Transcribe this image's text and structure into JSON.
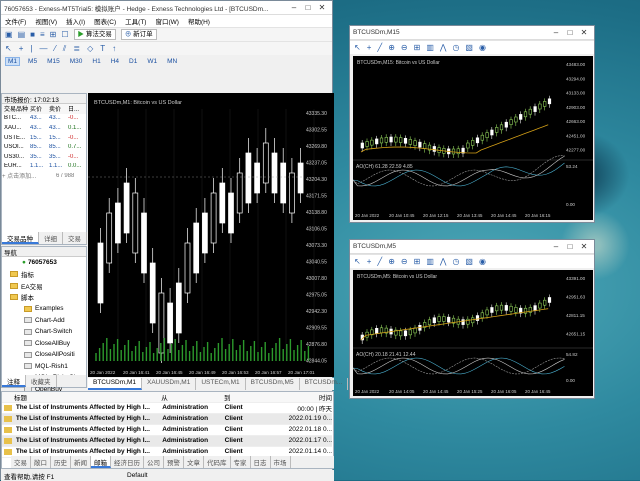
{
  "main": {
    "title": "76057653 - Exness-MT5Trial5: 模拟账户 - Hedge - Exness Technologies Ltd - [BTCUSDm...",
    "menu": [
      "文件(F)",
      "视图(V)",
      "插入(I)",
      "图表(C)",
      "工具(T)",
      "窗口(W)",
      "帮助(H)"
    ],
    "algo_label": "算法交易",
    "new_order_label": "新订单",
    "timeframes": [
      "M1",
      "M5",
      "M15",
      "M30",
      "H1",
      "H4",
      "D1",
      "W1",
      "MN"
    ],
    "mw_header": "市场报价: 17:02:13",
    "mw_cols": [
      "交易品种",
      "买价",
      "卖价",
      "日..."
    ],
    "mw_rows": [
      [
        "BTC...",
        "43...",
        "43...",
        "-0..."
      ],
      [
        "XAU...",
        "43...",
        "43...",
        "0.1..."
      ],
      [
        "USTE...",
        "15...",
        "15...",
        "-0..."
      ],
      [
        "USOI...",
        "85...",
        "85...",
        "0.7..."
      ],
      [
        "US30...",
        "35...",
        "35...",
        "-0..."
      ],
      [
        "EUR...",
        "1.1...",
        "1.1...",
        "0.0..."
      ]
    ],
    "mw_footer": "+ 点击添加...",
    "mw_count": "6 / 988",
    "mw_tabs": [
      "交易品种",
      "详细",
      "交易"
    ],
    "nav_header": "导航",
    "nav_items": [
      "76057653",
      "指标",
      "EA交易",
      "脚本",
      "Examples",
      "Chart-Add",
      "Chart-Switch",
      "CloseAllBuy",
      "CloseAllPositi",
      "MQL-Rish1",
      "MQL_Rick_Ch",
      "OpenBuy"
    ],
    "nav_tabs": [
      "注释",
      "收藏夹"
    ],
    "chart_title": "BTCUSDm,M1: Bitcoin vs US Dollar",
    "price_labels": [
      "43335.30",
      "43302.55",
      "43269.80",
      "43237.05",
      "43204.30",
      "43171.55",
      "43138.80",
      "43106.05",
      "43073.30",
      "43040.55",
      "43007.80",
      "42975.05",
      "42942.30",
      "42909.55",
      "42876.80",
      "42844.05"
    ],
    "time_labels": [
      "20 Jan 2022",
      "20 Jan 16:41",
      "20 Jan 16:45",
      "20 Jan 16:49",
      "20 Jan 16:53",
      "20 Jan 16:57",
      "20 Jan 17:01"
    ],
    "chart_tabs": [
      "BTCUSDm,M1",
      "XAUUSDm,M1",
      "USTECm,M1",
      "BTCUSDm,M5",
      "BTCUSDm..."
    ],
    "toolbox_cols": [
      "标题",
      "从",
      "到",
      "时间"
    ],
    "toolbox_rows": [
      [
        "The List of Instruments Affected by High I...",
        "Administration",
        "Client",
        "00:00 | 昨天"
      ],
      [
        "The List of Instruments Affected by High I...",
        "Administration",
        "Client",
        "2022.01.19 0..."
      ],
      [
        "The List of Instruments Affected by High I...",
        "Administration",
        "Client",
        "2022.01.18 0..."
      ],
      [
        "The List of Instruments Affected by High I...",
        "Administration",
        "Client",
        "2022.01.17 0..."
      ],
      [
        "The List of Instruments Affected by High I...",
        "Administration",
        "Client",
        "2022.01.14 0..."
      ]
    ],
    "toolbox_tabs": [
      "交易",
      "敞口",
      "历史",
      "新闻",
      "邮箱",
      "经济日历",
      "公司",
      "预警",
      "文章",
      "代码库",
      "专家",
      "日志",
      "市场"
    ],
    "status": {
      "help": "查看帮助,请按 F1",
      "profile": "Default"
    },
    "toolbox_label": "工具箱"
  },
  "m15": {
    "title": "BTCUSDm,M15",
    "chart_title": "BTCUSDm,M15: Bitcoin vs US Dollar",
    "prices": [
      "43483.00",
      "43294.00",
      "43133.00",
      "42903.00",
      "42663.00",
      "42451.00",
      "42277.00"
    ],
    "ind": "AO(CH) 61.28 22.59 4.85",
    "ind_vals": [
      "53.24",
      "0.00"
    ],
    "times": [
      "20 Jan 2022",
      "20 Jan 10:45",
      "20 Jan 12:15",
      "20 Jan 13:45",
      "20 Jan 14:45",
      "20 Jan 16:15"
    ]
  },
  "m5": {
    "title": "BTCUSDm,M5",
    "chart_title": "BTCUSDm,M5: Bitcoin vs US Dollar",
    "prices": [
      "43391.00",
      "42951.63",
      "42811.15",
      "42651.15"
    ],
    "ind": "AO(CH) 20.18 21.41 12.44",
    "ind_vals": [
      "54.82",
      "0.00"
    ],
    "times": [
      "20 Jan 2022",
      "20 Jan 14:05",
      "20 Jan 14:45",
      "20 Jan 15:25",
      "20 Jan 16:05",
      "20 Jan 16:45"
    ]
  }
}
